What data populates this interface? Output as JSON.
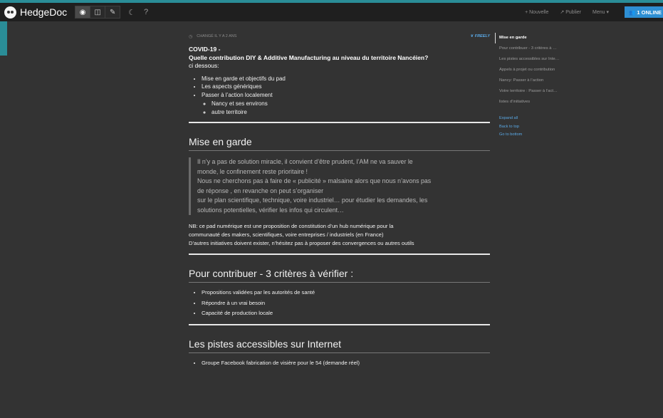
{
  "navbar": {
    "brand": "HedgeDoc",
    "modes": [
      "view",
      "both",
      "edit"
    ],
    "new_label": "+ Nouvelle",
    "publish_label": "Publier",
    "menu_label": "Menu ▾",
    "online_label": "1 ONLINE"
  },
  "doc": {
    "changed": "CHANGÉ IL Y A 2 ANS",
    "permission": "FREELY",
    "title_line1": "COVID-19 -",
    "title_line2": "Quelle contribution DIY & Additive Manufacturing au niveau du territoire Nancéien?",
    "title_line3": "ci dessous:",
    "toc_list": [
      "Mise en garde et objectifs du pad",
      "Les aspects génériques",
      "Passer à l’action localement"
    ],
    "toc_sub": [
      "Nancy et ses environs",
      "autre territoire"
    ],
    "h_mise_en_garde": "Mise en garde",
    "quote": [
      "Il n’y a pas de solution miracle, il convient d’être prudent, l’AM ne va sauver le",
      "monde, le confinement reste prioritaire !",
      "Nous ne cherchons pas à faire de « publicité » malsaine alors que nous n’avons pas",
      "de réponse , en revanche on peut s’organiser",
      "sur le plan scientifique, technique, voire industriel… pour étudier les demandes, les",
      "solutions potentielles, vérifier les infos qui circulent…"
    ],
    "nb": [
      "NB: ce pad numérique est une proposition de constitution d’un hub numérique pour la",
      "communauté des makers, scientifiques, voire entreprises / industriels (en France)",
      "D’autres initiatives doivent exister, n’hésitez pas à proposer des convergences ou autres outils"
    ],
    "h_contribuer": "Pour contribuer - 3 critères à vérifier :",
    "criteres": [
      "Propositions validées par les autorités de santé",
      "Répondre à un vrai besoin",
      "Capacité de production locale"
    ],
    "h_pistes": "Les pistes accessibles sur Internet",
    "pistes": [
      "Groupe Facebook fabrication de visière pour le 54 (demande réel)"
    ]
  },
  "toc": {
    "items": [
      "Mise en garde",
      "Pour contribuer - 3 critères à …",
      "Les pistes accessibles sur Inte…",
      "Appels à projet ou contribution",
      "Nancy: Passer à l’action",
      "Votre territoire : Passer à l’act…",
      "listes d’initiatives"
    ],
    "expand_all": "Expand all",
    "back_to_top": "Back to top",
    "go_to_bottom": "Go to bottom"
  },
  "colors": {
    "accent": "#2e8fd3",
    "link": "#5aa9e6",
    "background": "#333333",
    "navbar": "#1f1f1f"
  },
  "icons": {
    "view": "eye-icon",
    "both": "columns-icon",
    "edit": "pencil-icon",
    "night": "moon-icon",
    "help": "question-icon",
    "clock": "clock-icon",
    "permission": "leaf-icon",
    "publish": "share-icon",
    "online": "users-icon"
  }
}
